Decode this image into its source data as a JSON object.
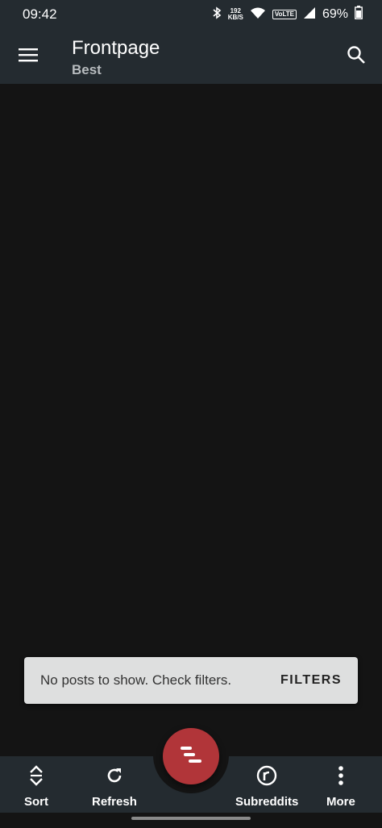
{
  "status_bar": {
    "time": "09:42",
    "net_speed_value": "192",
    "net_speed_unit": "KB/S",
    "volte": "VoLTE",
    "battery": "69%"
  },
  "app_bar": {
    "title": "Frontpage",
    "subtitle": "Best",
    "menu_icon": "hamburger-menu-icon",
    "search_icon": "search-icon"
  },
  "snackbar": {
    "message": "No posts to show. Check filters.",
    "action": "FILTERS"
  },
  "bottom_nav": {
    "items": [
      {
        "label": "Sort",
        "icon": "sort-icon"
      },
      {
        "label": "Refresh",
        "icon": "refresh-icon"
      },
      {
        "label": "Subreddits",
        "icon": "subreddits-icon"
      },
      {
        "label": "More",
        "icon": "more-vertical-icon"
      }
    ],
    "fab_icon": "menu-lines-icon"
  },
  "colors": {
    "bar_background": "#242b30",
    "content_background": "#141414",
    "fab": "#b13539",
    "snackbar": "#dedfdf"
  }
}
